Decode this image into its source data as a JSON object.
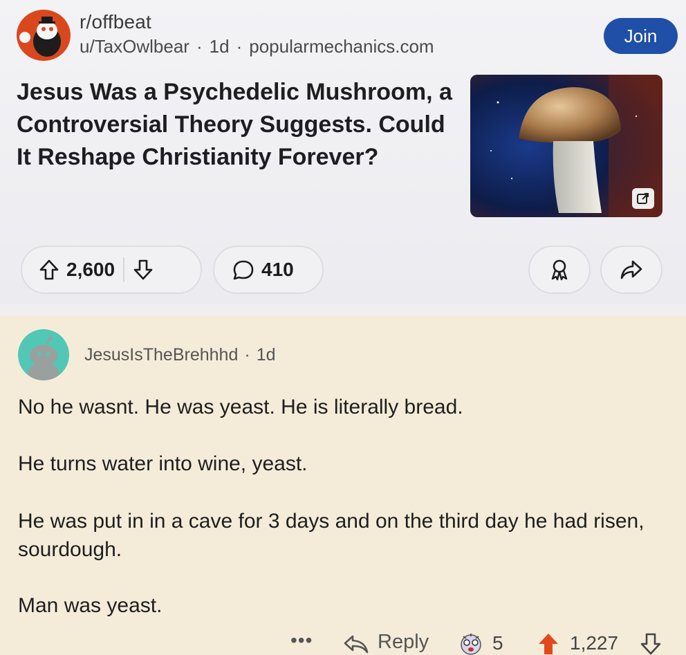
{
  "post": {
    "subreddit": "r/offbeat",
    "author": "u/TaxOwlbear",
    "age": "1d",
    "domain": "popularmechanics.com",
    "join_label": "Join",
    "title": "Jesus Was a Psychedelic Mushroom, a Controversial Theory Suggests. Could It Reshape Christianity Forever?",
    "upvotes": "2,600",
    "comments": "410"
  },
  "comment": {
    "author": "JesusIsTheBrehhhd",
    "age": "1d",
    "paragraphs": [
      "No he wasnt. He was yeast. He is literally bread.",
      "He turns water into wine, yeast.",
      "He was put in in a cave for 3 days and on the third day he had risen, sourdough.",
      "Man was yeast."
    ],
    "more": "•••",
    "reply_label": "Reply",
    "award_count": "5",
    "score": "1,227"
  },
  "colors": {
    "join_bg": "#1f4fa6",
    "upvote_accent": "#e2481d",
    "comment_bg": "#f4ecd9",
    "avatar_user": "#52c7b5"
  },
  "icons": [
    "upvote-icon",
    "downvote-icon",
    "comment-icon",
    "save-icon",
    "share-icon",
    "external-link-icon",
    "reply-icon",
    "award-icon"
  ]
}
